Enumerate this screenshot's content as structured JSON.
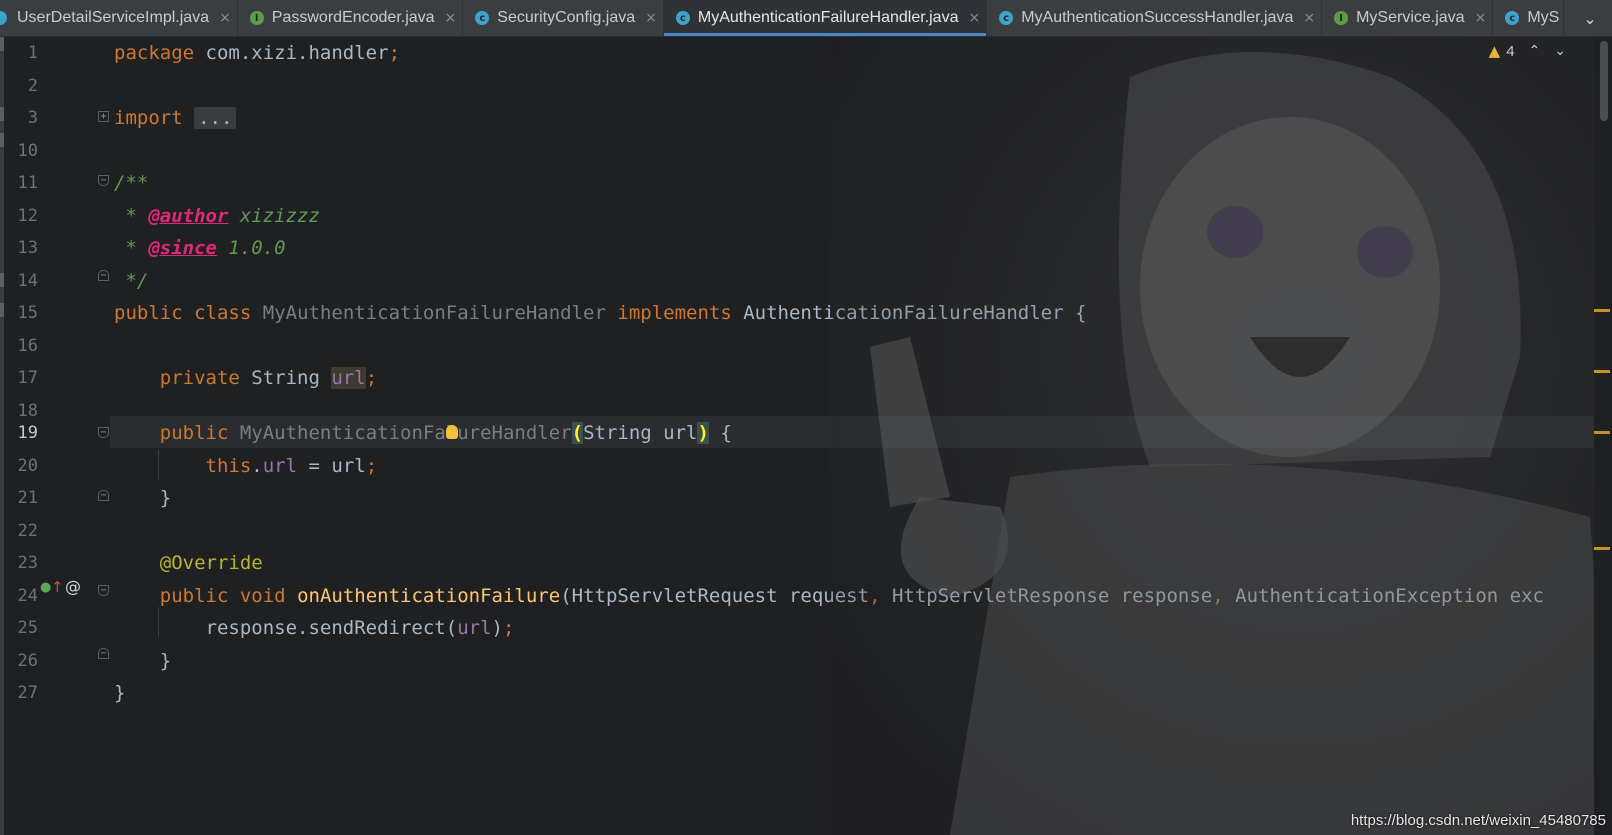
{
  "tabs": [
    {
      "label": "UserDetailServiceImpl.java",
      "icon": "class-icon",
      "active": false
    },
    {
      "label": "PasswordEncoder.java",
      "icon": "interface-icon",
      "active": false
    },
    {
      "label": "SecurityConfig.java",
      "icon": "class-icon",
      "active": false
    },
    {
      "label": "MyAuthenticationFailureHandler.java",
      "icon": "class-icon",
      "active": true
    },
    {
      "label": "MyAuthenticationSuccessHandler.java",
      "icon": "class-icon",
      "active": false
    },
    {
      "label": "MyService.java",
      "icon": "interface-icon",
      "active": false
    },
    {
      "label": "MyS",
      "icon": "class-icon",
      "active": false
    }
  ],
  "tab_close_glyph": "×",
  "tab_icon_letters": {
    "class": "c",
    "interface": "I"
  },
  "inspection": {
    "warning_count": "4"
  },
  "gutter": {
    "line_numbers": [
      "1",
      "2",
      "3",
      "10",
      "11",
      "12",
      "13",
      "14",
      "15",
      "16",
      "17",
      "18",
      "19",
      "20",
      "21",
      "22",
      "23",
      "24",
      "25",
      "26",
      "27"
    ],
    "current_line": "19",
    "implements_marker": "@"
  },
  "code": {
    "l1": {
      "kw": "package",
      "pkg": "com.xizi.handler",
      "semi": ";"
    },
    "l3": {
      "kw": "import",
      "folded": "..."
    },
    "l11": {
      "text": "/**"
    },
    "l12": {
      "star": " * ",
      "tag": "@author",
      "value": " xizizzz"
    },
    "l13": {
      "star": " * ",
      "tag": "@since",
      "value": " 1.0.0"
    },
    "l14": {
      "text": " */"
    },
    "l15": {
      "kw1": "public",
      "kw2": "class",
      "name": "MyAuthenticationFailureHandler",
      "kw3": "implements",
      "iface": "AuthenticationFailureHandler",
      "brace": " {"
    },
    "l17": {
      "kw": "private",
      "type": "String",
      "field": "url",
      "semi": ";"
    },
    "l19": {
      "kw": "public",
      "name_a": "MyAuthenticationFa",
      "name_b": "lureHandler",
      "open": "(",
      "params": "String url",
      "close": ")",
      "brace": " {"
    },
    "l20": {
      "kw": "this",
      "dot": ".",
      "field": "url",
      "rest": " = url",
      "semi": ";"
    },
    "l21": {
      "text": "}"
    },
    "l23": {
      "annot": "@Override"
    },
    "l24": {
      "kw1": "public",
      "kw2": "void",
      "method": "onAuthenticationFailure",
      "open": "(",
      "p1": "HttpServletRequest request",
      "c1": ",",
      "p2": " HttpServletResponse response",
      "c2": ",",
      "p3": " AuthenticationException exc"
    },
    "l25": {
      "obj": "response.sendRedirect(",
      "field": "url",
      "close": ")",
      "semi": ";"
    },
    "l26": {
      "text": "}"
    },
    "l27": {
      "text": "}"
    }
  },
  "watermark": "https://blog.csdn.net/weixin_45480785",
  "colors": {
    "keyword": "#cc7832",
    "field": "#9876aa",
    "comment": "#629755",
    "doc_tag": "#e0287a",
    "annotation": "#bbb529",
    "method": "#ffc66d",
    "accent": "#4a88c7"
  }
}
